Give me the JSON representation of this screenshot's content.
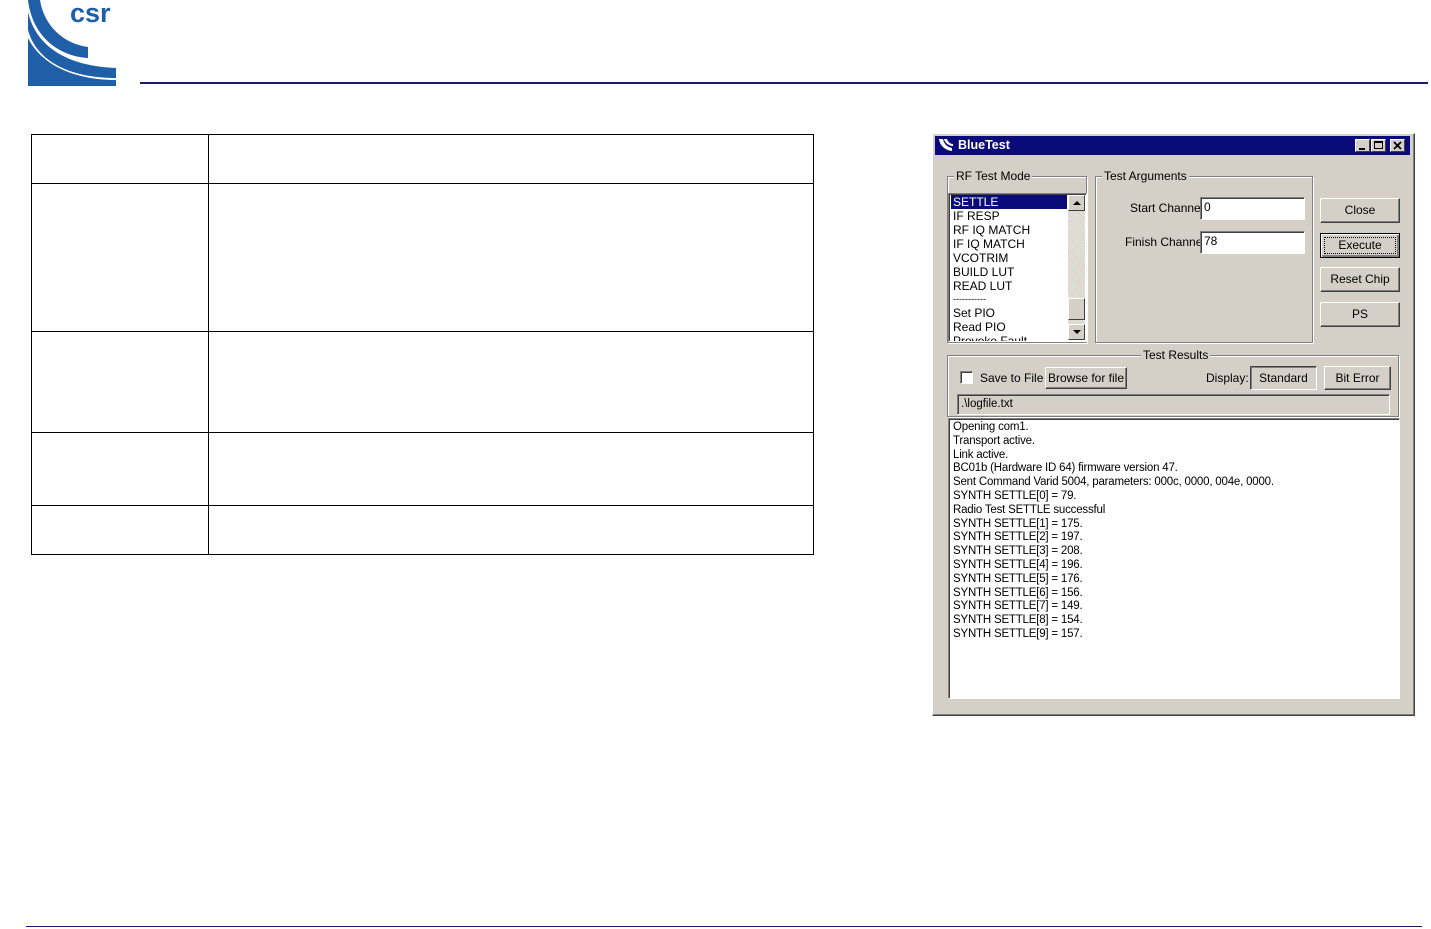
{
  "header": {
    "logo_text": "csr"
  },
  "dialog": {
    "title": "BlueTest",
    "rf_test_mode": {
      "label": "RF Test Mode",
      "items": [
        "SETTLE",
        "IF RESP",
        "RF IQ MATCH",
        "IF IQ MATCH",
        "VCOTRIM",
        "BUILD LUT",
        "READ LUT",
        "-----------",
        "Set PIO",
        "Read PIO",
        "Provoke Fault"
      ],
      "selected": "SETTLE"
    },
    "test_arguments": {
      "label": "Test Arguments",
      "start_channel_label": "Start Channel",
      "start_channel_value": "0",
      "finish_channel_label": "Finish Channel",
      "finish_channel_value": "78"
    },
    "buttons": {
      "close": "Close",
      "execute": "Execute",
      "reset_chip": "Reset Chip",
      "ps": "PS"
    },
    "test_results": {
      "label": "Test Results",
      "save_to_file_label": "Save to File",
      "save_to_file_checked": false,
      "browse_label": "Browse for file",
      "display_label": "Display:",
      "standard_label": "Standard",
      "bit_error_label": "Bit Error",
      "log_path": ".\\logfile.txt",
      "lines": [
        "Opening com1.",
        "Transport active.",
        "Link active.",
        "BC01b (Hardware ID 64) firmware version 47.",
        "Sent Command Varid 5004, parameters: 000c, 0000, 004e, 0000.",
        "SYNTH SETTLE[0] = 79.",
        "Radio Test SETTLE successful",
        "SYNTH SETTLE[1] = 175.",
        "SYNTH SETTLE[2] = 197.",
        "SYNTH SETTLE[3] = 208.",
        "SYNTH SETTLE[4] = 196.",
        "SYNTH SETTLE[5] = 176.",
        "SYNTH SETTLE[6] = 156.",
        "SYNTH SETTLE[7] = 149.",
        "SYNTH SETTLE[8] = 154.",
        "SYNTH SETTLE[9] = 157."
      ]
    }
  },
  "colors": {
    "brand_blue": "#1f5fa8",
    "rule_navy": "#1a1a6e",
    "titlebar": "#0a0a7a",
    "dialog_face": "#d4d0c8"
  }
}
